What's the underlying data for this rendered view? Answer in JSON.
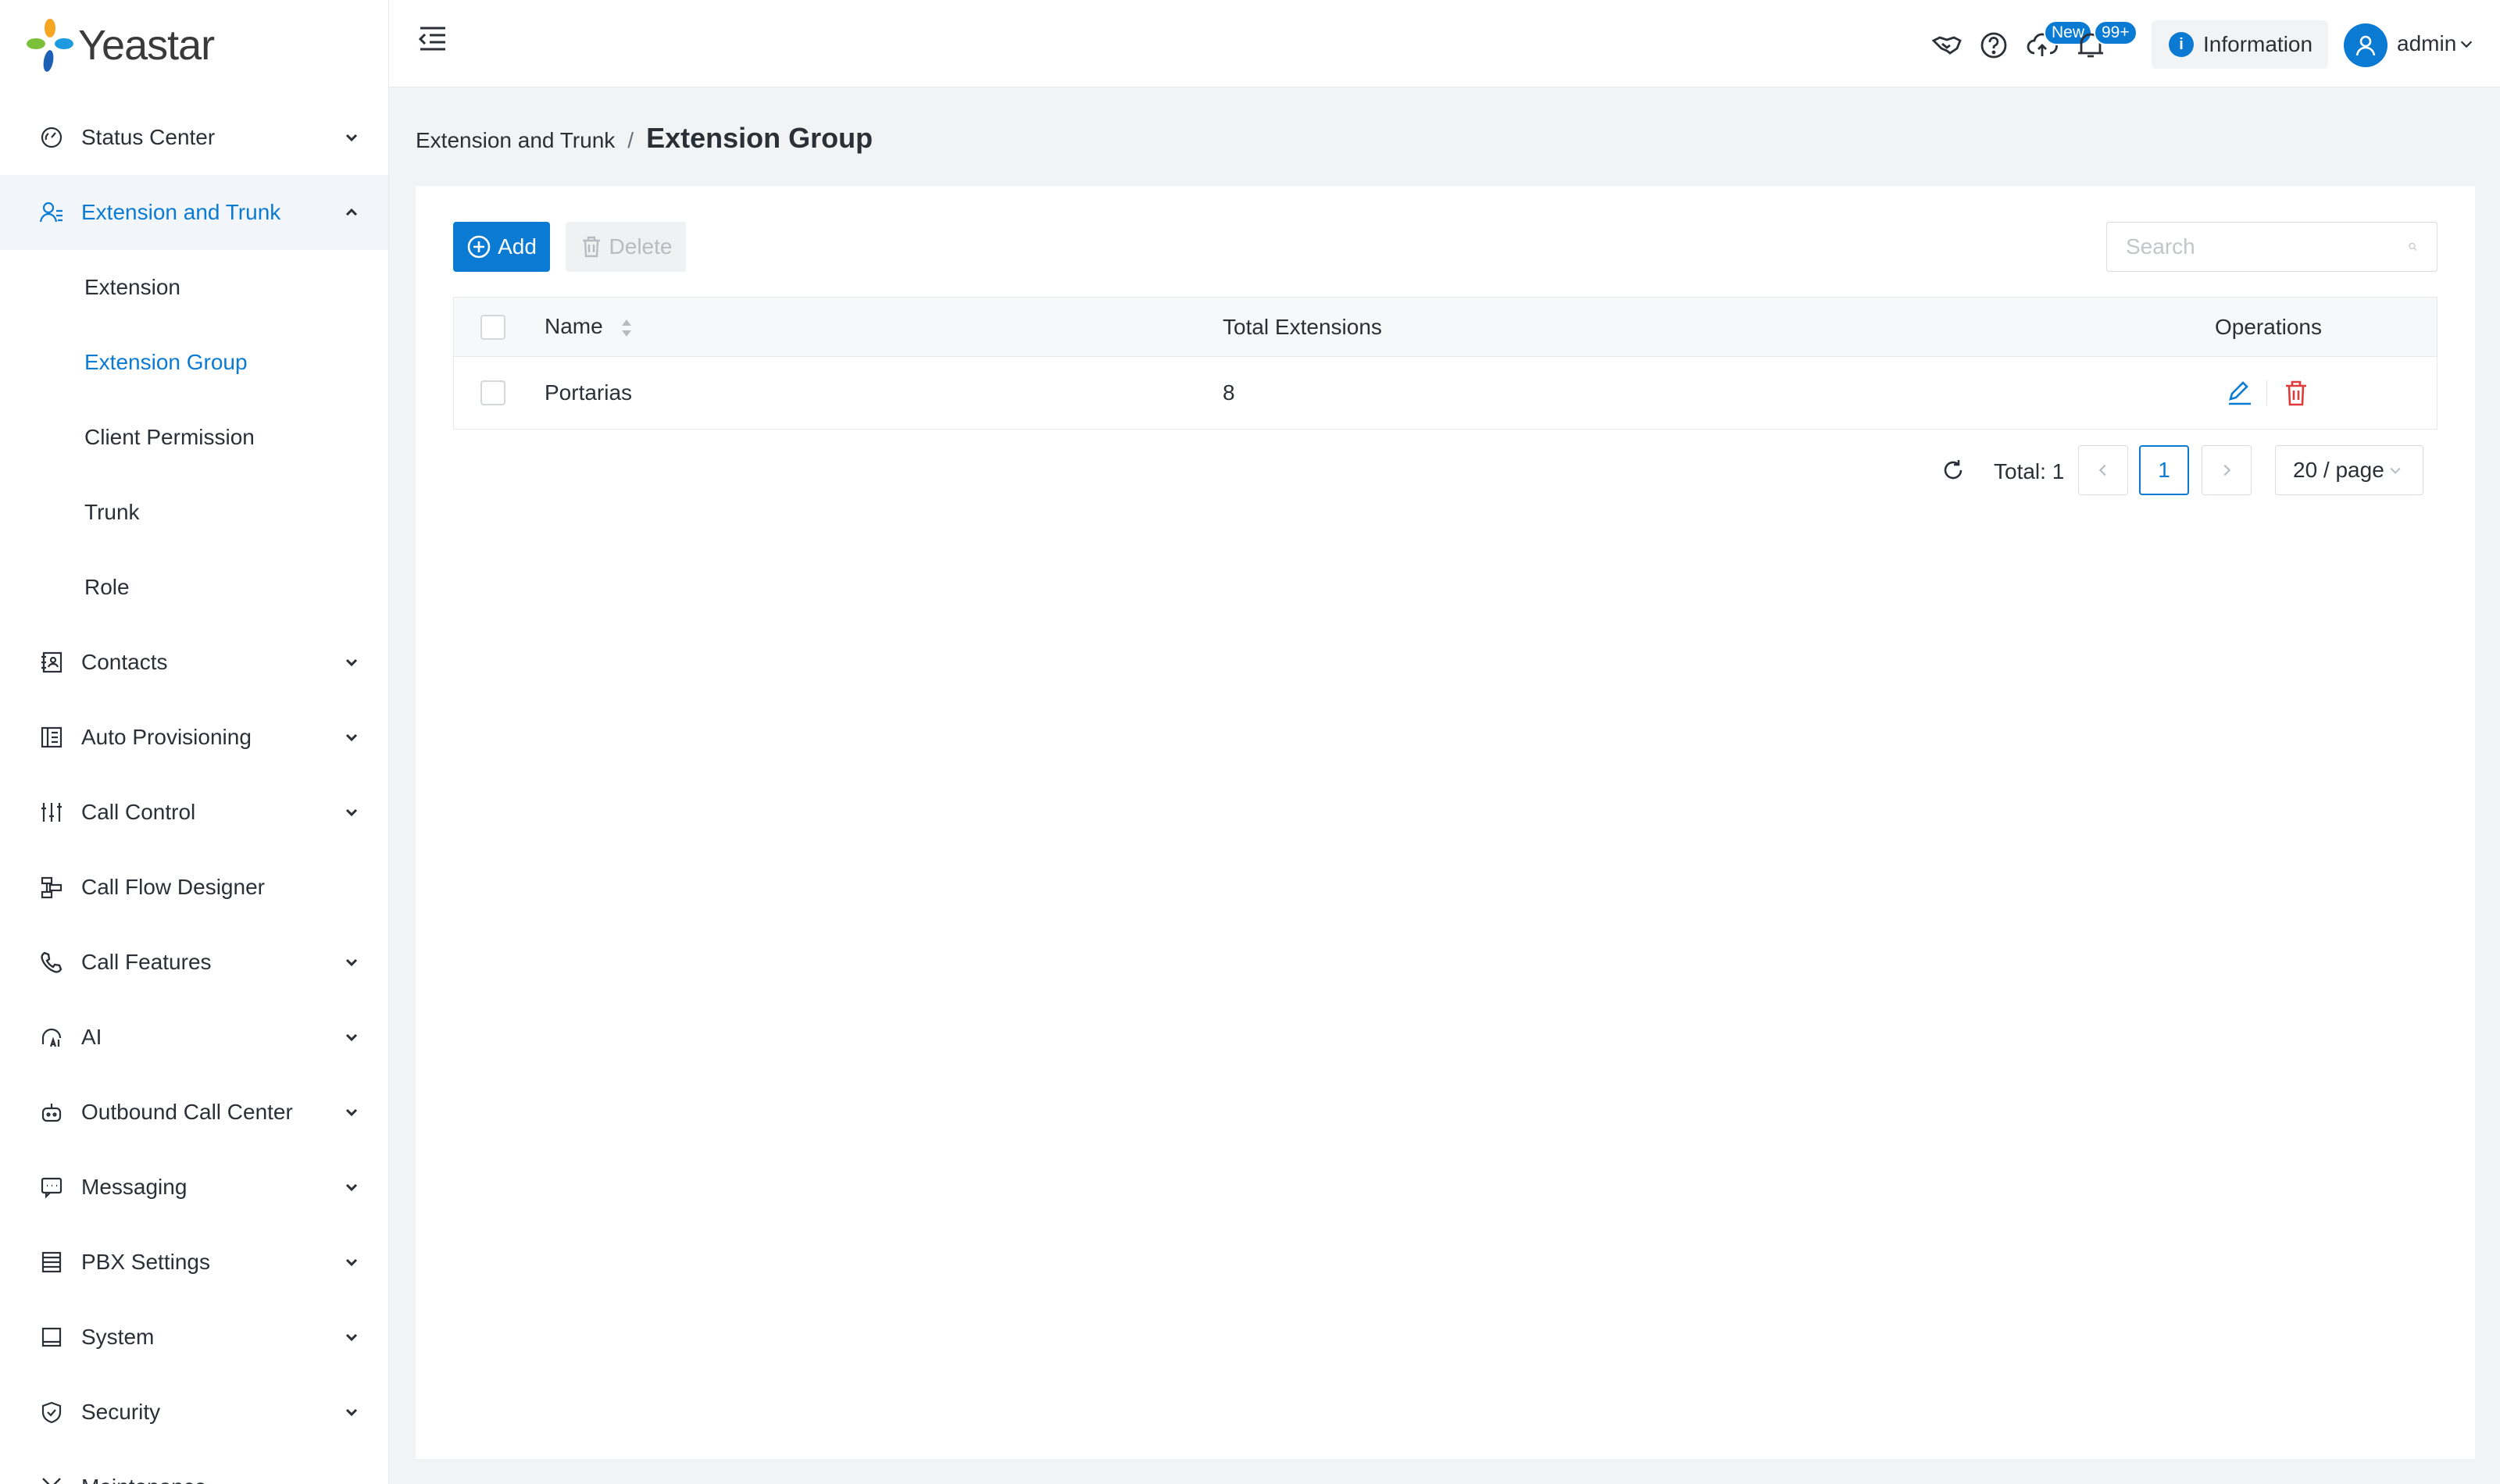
{
  "brand": {
    "name": "Yeastar"
  },
  "sidebar": {
    "items": [
      {
        "label": "Status Center",
        "icon": "gauge-icon"
      },
      {
        "label": "Extension and Trunk",
        "icon": "users-icon",
        "open": true
      },
      {
        "label": "Contacts",
        "icon": "contacts-icon"
      },
      {
        "label": "Auto Provisioning",
        "icon": "provisioning-icon"
      },
      {
        "label": "Call Control",
        "icon": "sliders-icon"
      },
      {
        "label": "Call Flow Designer",
        "icon": "flow-icon"
      },
      {
        "label": "Call Features",
        "icon": "phone-icon"
      },
      {
        "label": "AI",
        "icon": "ai-icon"
      },
      {
        "label": "Outbound Call Center",
        "icon": "robot-icon"
      },
      {
        "label": "Messaging",
        "icon": "message-icon"
      },
      {
        "label": "PBX Settings",
        "icon": "server-icon"
      },
      {
        "label": "System",
        "icon": "monitor-icon"
      },
      {
        "label": "Security",
        "icon": "shield-icon"
      },
      {
        "label": "Maintenance",
        "icon": "tools-icon"
      }
    ],
    "sub_items": [
      {
        "label": "Extension"
      },
      {
        "label": "Extension Group",
        "active": true
      },
      {
        "label": "Client Permission"
      },
      {
        "label": "Trunk"
      },
      {
        "label": "Role"
      }
    ]
  },
  "header": {
    "new_badge": "New",
    "notif_badge": "99+",
    "info_label": "Information",
    "user": "admin"
  },
  "breadcrumb": {
    "parent": "Extension and Trunk",
    "separator": "/",
    "current": "Extension Group"
  },
  "toolbar": {
    "add_label": "Add",
    "delete_label": "Delete",
    "search_placeholder": "Search"
  },
  "table": {
    "columns": [
      "Name",
      "Total Extensions",
      "Operations"
    ],
    "rows": [
      {
        "name": "Portarias",
        "total": "8"
      }
    ]
  },
  "pagination": {
    "total": "Total: 1",
    "current_page": "1",
    "page_size": "20 / page"
  },
  "colors": {
    "accent": "#0a7ad3",
    "danger": "#e03b3b"
  }
}
